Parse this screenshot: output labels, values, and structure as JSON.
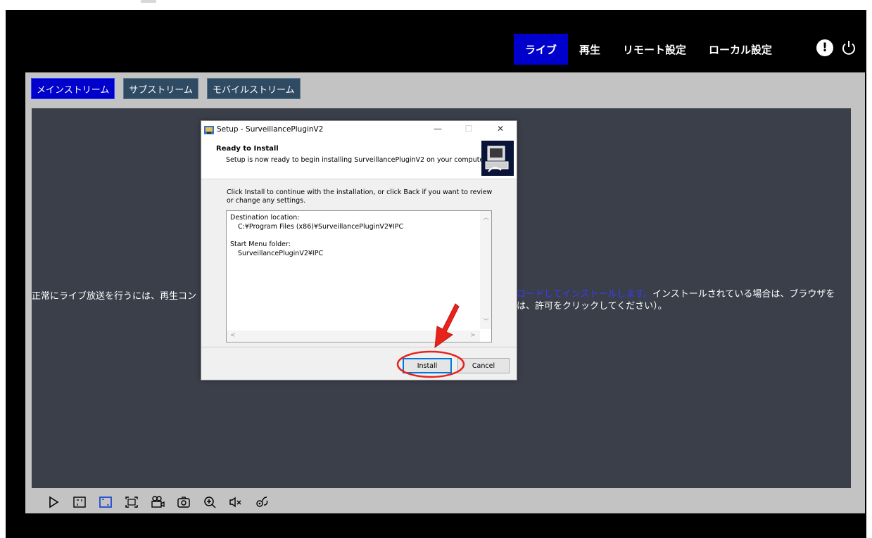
{
  "nav": {
    "items": [
      {
        "label": "ライブ",
        "active": true
      },
      {
        "label": "再生",
        "active": false
      },
      {
        "label": "リモート設定",
        "active": false
      },
      {
        "label": "ローカル設定",
        "active": false
      }
    ],
    "alert_icon": "alert-icon",
    "power_icon": "power-icon"
  },
  "streams": [
    {
      "label": "メインストリーム",
      "active": true
    },
    {
      "label": "サブストリーム",
      "active": false
    },
    {
      "label": "モバイルストリーム",
      "active": false
    }
  ],
  "message": {
    "left": "正常にライブ放送を行うには、再生コン",
    "right_link": "ロードしてインストールします。",
    "right_text1": "インストールされている場合は、ブラウザを",
    "right_text2": "は、許可をクリックしてください）。"
  },
  "toolbar": [
    "play-icon",
    "split-screen-icon",
    "original-ratio-icon",
    "fullscreen-icon",
    "record-icon",
    "snapshot-icon",
    "zoom-icon",
    "mute-icon",
    "ptz-icon"
  ],
  "dialog": {
    "title": "Setup - SurveillancePluginV2",
    "heading": "Ready to Install",
    "subheading": "Setup is now ready to begin installing SurveillancePluginV2 on your computer.",
    "instruction": "Click Install to continue with the installation, or click Back if you want to review or change any settings.",
    "memo": {
      "dest_label": "Destination location:",
      "dest_value": "C:¥Program Files (x86)¥SurveillancePluginV2¥IPC",
      "menu_label": "Start Menu folder:",
      "menu_value": "SurveillancePluginV2¥IPC"
    },
    "install_label": "Install",
    "cancel_label": "Cancel"
  },
  "colors": {
    "accent": "#0000cc",
    "annotation": "#e8231c"
  }
}
